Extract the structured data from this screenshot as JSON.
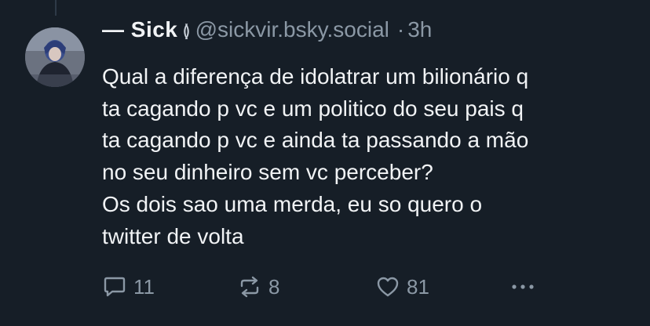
{
  "post": {
    "author": {
      "display_name": "— Sick",
      "name_glyph": "≬",
      "handle": "@sickvir.bsky.social"
    },
    "separator": "·",
    "timestamp": "3h",
    "body_lines": [
      "Qual a diferença de idolatrar um bilionário q",
      "ta cagando p vc e um politico do seu pais q",
      "ta cagando p vc e ainda ta passando a mão",
      "no seu dinheiro sem vc perceber?",
      "Os dois sao uma merda, eu so quero o",
      "twitter de volta"
    ],
    "actions": {
      "reply": {
        "icon": "reply-icon",
        "count": "11"
      },
      "repost": {
        "icon": "repost-icon",
        "count": "8"
      },
      "like": {
        "icon": "heart-icon",
        "count": "81"
      },
      "more": {
        "icon": "more-options-icon"
      }
    }
  },
  "colors": {
    "background": "#161e27",
    "text_primary": "#f1f3f5",
    "text_secondary": "#8b98a5",
    "thread_line": "#2e3a47"
  }
}
